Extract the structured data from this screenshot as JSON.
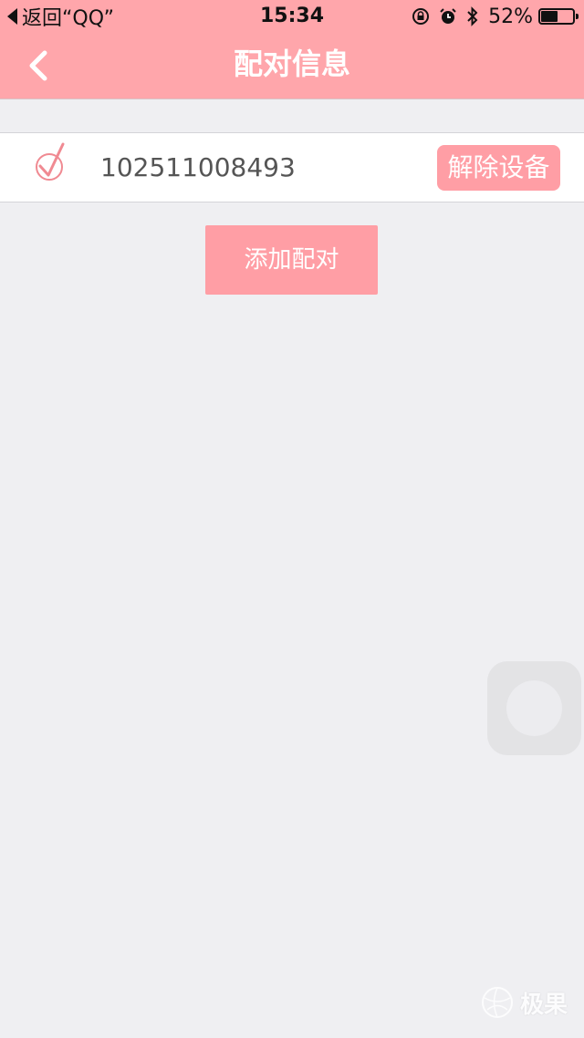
{
  "status_bar": {
    "back_label": "返回“QQ”",
    "time": "15:34",
    "battery_percent": "52%",
    "battery_level": 0.52
  },
  "nav": {
    "title": "配对信息",
    "back_icon": "chevron-left-icon"
  },
  "device": {
    "id": "102511008493",
    "status_icon": "check-icon",
    "unbind_label": "解除设备"
  },
  "actions": {
    "add_pair_label": "添加配对"
  },
  "watermark": {
    "text": "极果"
  },
  "colors": {
    "header": "#ffa6ab",
    "accent": "#ff9ea5",
    "background": "#efeff2",
    "check": "#f08a92"
  }
}
